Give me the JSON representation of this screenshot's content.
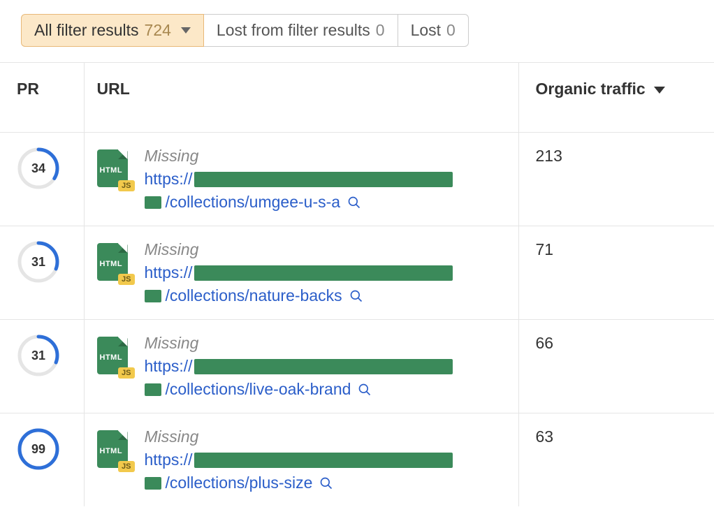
{
  "tabs": [
    {
      "label": "All filter results",
      "count": "724",
      "active": true,
      "has_caret": true
    },
    {
      "label": "Lost from filter results",
      "count": "0",
      "active": false,
      "has_caret": false
    },
    {
      "label": "Lost",
      "count": "0",
      "active": false,
      "has_caret": false
    }
  ],
  "columns": {
    "pr": "PR",
    "url": "URL",
    "traffic": "Organic traffic"
  },
  "file_icon": {
    "type_label": "HTML",
    "badge": "JS"
  },
  "rows": [
    {
      "pr": "34",
      "pr_pct": 34,
      "status": "Missing",
      "scheme": "https://",
      "path": "/collections/umgee-u-s-a",
      "traffic": "213"
    },
    {
      "pr": "31",
      "pr_pct": 31,
      "status": "Missing",
      "scheme": "https://",
      "path": "/collections/nature-backs",
      "traffic": "71"
    },
    {
      "pr": "31",
      "pr_pct": 31,
      "status": "Missing",
      "scheme": "https://",
      "path": "/collections/live-oak-brand",
      "traffic": "66"
    },
    {
      "pr": "99",
      "pr_pct": 99,
      "status": "Missing",
      "scheme": "https://",
      "path": "/collections/plus-size",
      "traffic": "63"
    }
  ]
}
